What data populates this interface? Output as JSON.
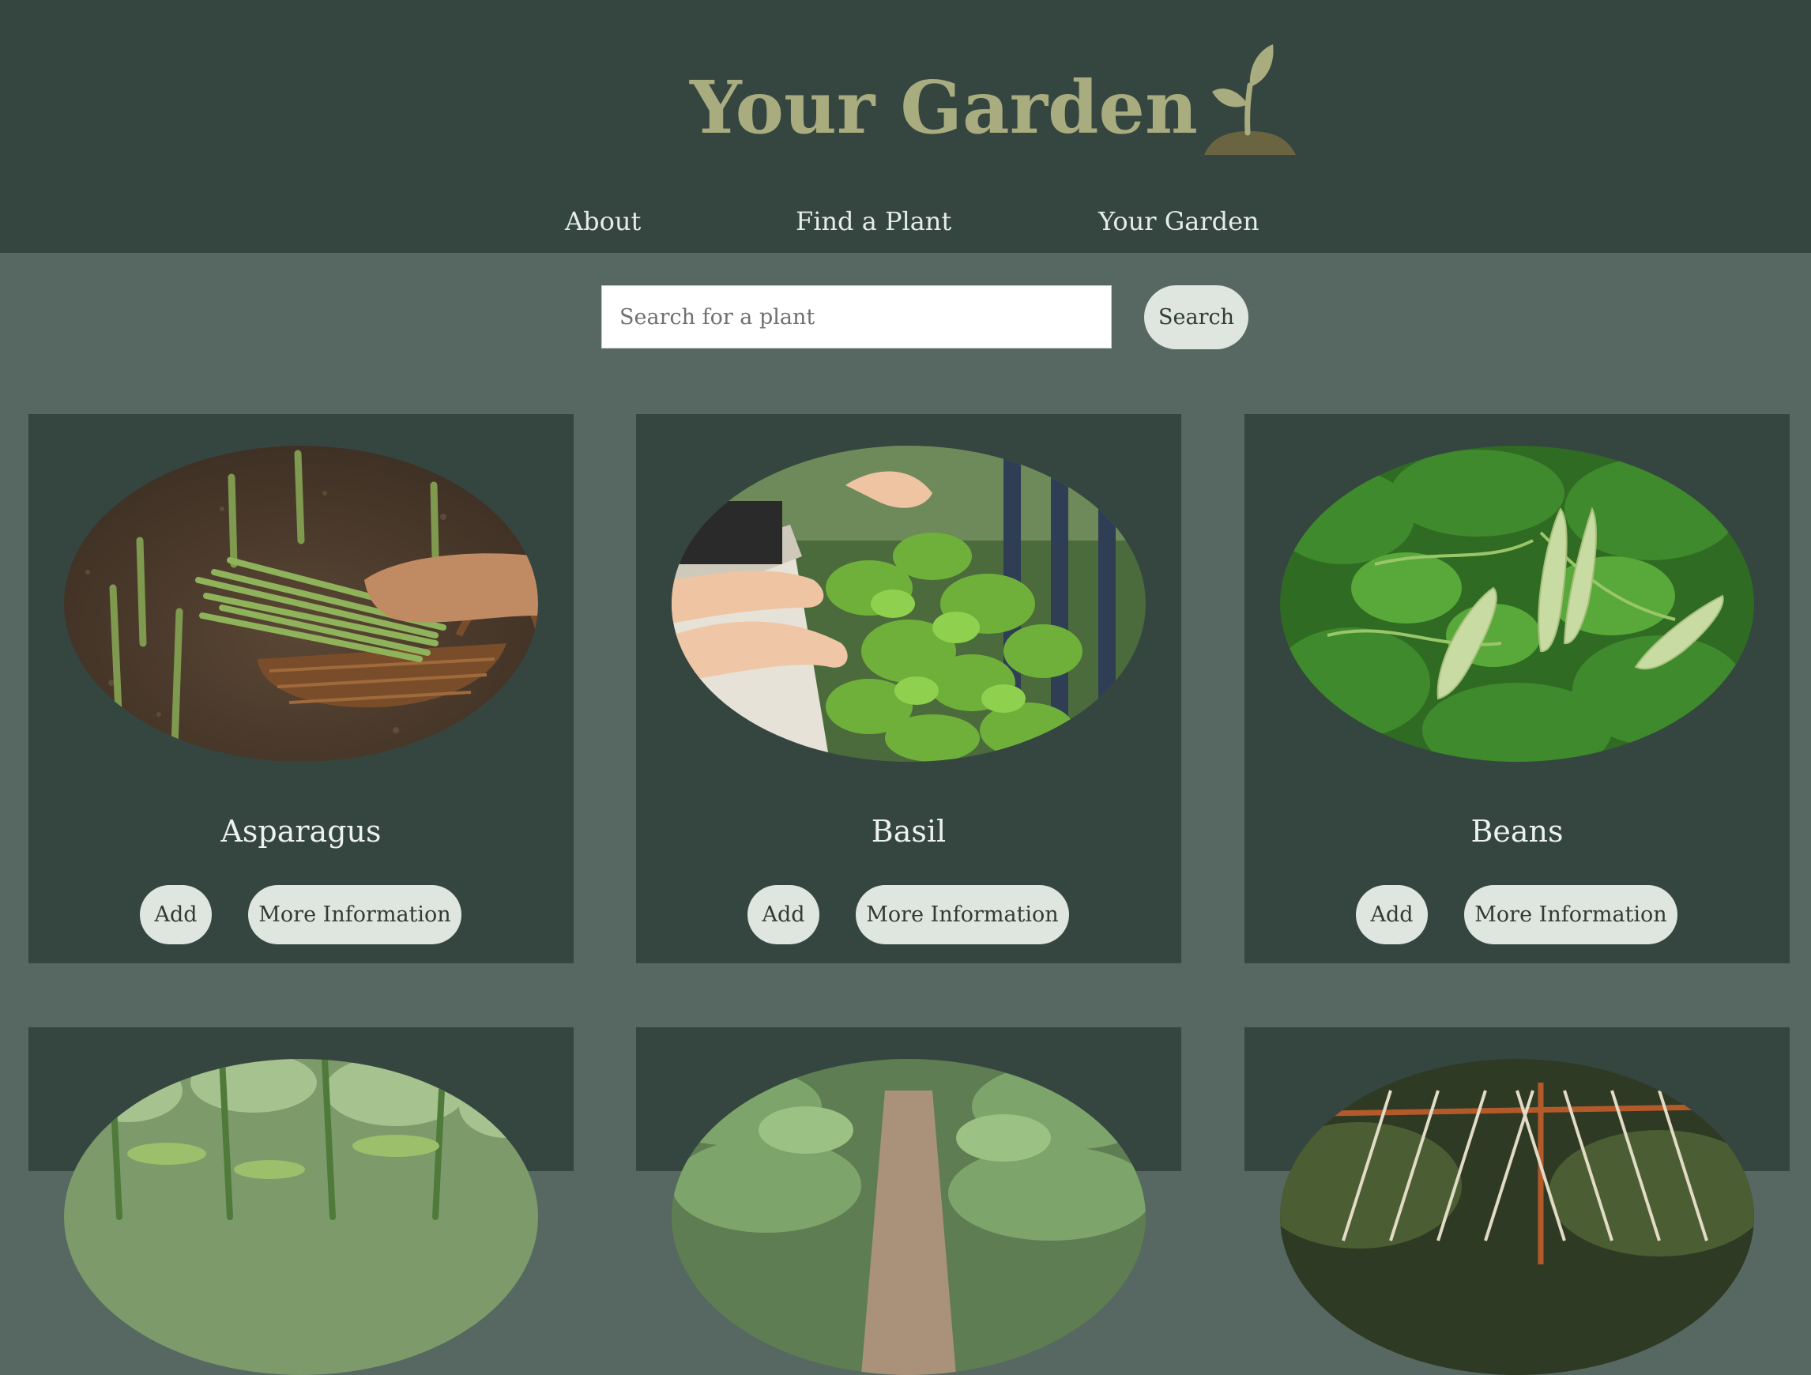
{
  "header": {
    "title": "Your Garden",
    "logo_icon": "sprout-icon"
  },
  "nav": {
    "items": [
      {
        "label": "About"
      },
      {
        "label": "Find a Plant"
      },
      {
        "label": "Your Garden"
      }
    ]
  },
  "search": {
    "placeholder": "Search for a plant",
    "value": "",
    "button_label": "Search"
  },
  "plants": [
    {
      "name": "Asparagus",
      "add_label": "Add",
      "info_label": "More Information"
    },
    {
      "name": "Basil",
      "add_label": "Add",
      "info_label": "More Information"
    },
    {
      "name": "Beans",
      "add_label": "Add",
      "info_label": "More Information"
    },
    {
      "name": "",
      "add_label": "",
      "info_label": ""
    },
    {
      "name": "",
      "add_label": "",
      "info_label": ""
    },
    {
      "name": "",
      "add_label": "",
      "info_label": ""
    }
  ],
  "colors": {
    "header_bg": "#354641",
    "page_bg": "#566861",
    "card_bg": "#354641",
    "title": "#a9ac7e",
    "button_bg": "#dfe5df"
  }
}
